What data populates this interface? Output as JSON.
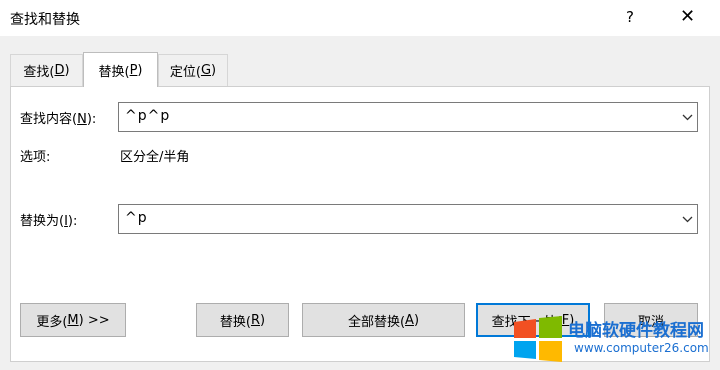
{
  "window": {
    "title": "查找和替换",
    "help": "?",
    "close": "✕"
  },
  "tabs": [
    {
      "label": "查找(",
      "key": "D",
      "suffix": ")"
    },
    {
      "label": "替换(",
      "key": "P",
      "suffix": ")"
    },
    {
      "label": "定位(",
      "key": "G",
      "suffix": ")"
    }
  ],
  "find": {
    "label": "查找内容(",
    "key": "N",
    "suffix": "):",
    "value": "^p^p"
  },
  "options": {
    "label": "选项:",
    "value": "区分全/半角"
  },
  "replace": {
    "label": "替换为(",
    "key": "I",
    "suffix": "):",
    "value": "^p"
  },
  "buttons": {
    "more": {
      "label": "更多(",
      "key": "M",
      "suffix": ") >>"
    },
    "replace": {
      "label": "替换(",
      "key": "R",
      "suffix": ")"
    },
    "replace_all": {
      "label": "全部替换(",
      "key": "A",
      "suffix": ")"
    },
    "find_next": {
      "label": "查找下一处(",
      "key": "F",
      "suffix": ")"
    },
    "cancel": {
      "label": "取消"
    }
  },
  "watermark": {
    "title": "电脑软硬件教程网",
    "url": "www.computer26.com"
  },
  "colors": {
    "accent": "#0078d7",
    "watermark_text": "#1b6fd1"
  }
}
